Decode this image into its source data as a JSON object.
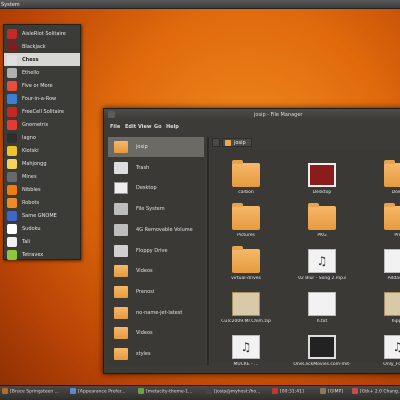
{
  "topbar": {
    "system_label": "System"
  },
  "games_menu": {
    "items": [
      {
        "label": "AisleRiot Solitaire",
        "color": "#c62828"
      },
      {
        "label": "Blackjack",
        "color": "#7b1f1f"
      },
      {
        "label": "Chess",
        "color": "#e0e0e0"
      },
      {
        "label": "Ethello",
        "color": "#b0b0b0"
      },
      {
        "label": "Five or More",
        "color": "#e84e3c"
      },
      {
        "label": "Four-in-a-Row",
        "color": "#3f7fd1"
      },
      {
        "label": "FreeCell Solitaire",
        "color": "#c62828"
      },
      {
        "label": "Gnometris",
        "color": "#e53935"
      },
      {
        "label": "Iagno",
        "color": "#2e2e2e"
      },
      {
        "label": "Klotski",
        "color": "#f2c12e"
      },
      {
        "label": "Mahjongg",
        "color": "#f5d25f"
      },
      {
        "label": "Mines",
        "color": "#6a6a6a"
      },
      {
        "label": "Nibbles",
        "color": "#ef7d0f"
      },
      {
        "label": "Robots",
        "color": "#ed8c22"
      },
      {
        "label": "Same GNOME",
        "color": "#3f67c9"
      },
      {
        "label": "Sudoku",
        "color": "#ffffff"
      },
      {
        "label": "Tali",
        "color": "#f0f0f0"
      },
      {
        "label": "Tetravex",
        "color": "#8cc63f"
      }
    ],
    "active_index": 2
  },
  "file_manager": {
    "title": "josip - File Manager",
    "menubar": [
      "File",
      "Edit",
      "View",
      "Go",
      "Help"
    ],
    "path_label": "josip",
    "sidebar": [
      {
        "label": "josip",
        "icon": "home-folder-icon"
      },
      {
        "label": "Trash",
        "icon": "trash-icon"
      },
      {
        "label": "Desktop",
        "icon": "desktop-icon"
      },
      {
        "label": "File System",
        "icon": "drive-icon"
      },
      {
        "label": "4G Removable Volume",
        "icon": "drive-icon"
      },
      {
        "label": "Floppy Drive",
        "icon": "floppy-icon"
      },
      {
        "label": "Videos",
        "icon": "folder-icon"
      },
      {
        "label": "Prenosi",
        "icon": "folder-icon"
      },
      {
        "label": "no-name-jet-latest",
        "icon": "folder-icon"
      },
      {
        "label": "Videos",
        "icon": "folder-icon"
      },
      {
        "label": "styles",
        "icon": "folder-icon"
      }
    ],
    "files": [
      {
        "label": "carbon",
        "type": "folder"
      },
      {
        "label": "Desktop",
        "type": "desktop"
      },
      {
        "label": "Down",
        "type": "folder"
      },
      {
        "label": "Pictures",
        "type": "folder"
      },
      {
        "label": "PKG",
        "type": "folder"
      },
      {
        "label": "Pre",
        "type": "folder"
      },
      {
        "label": "virtual-drives",
        "type": "folder"
      },
      {
        "label": "02 Blur - Song 2.mp3",
        "type": "mp3"
      },
      {
        "label": "Addas_Gl",
        "type": "doc"
      },
      {
        "label": "CuTc2009.Mr.Chim.zip",
        "type": "zip"
      },
      {
        "label": "h.txt",
        "type": "doc"
      },
      {
        "label": "hipph",
        "type": "zip"
      },
      {
        "label": "MUCKE - ...",
        "type": "mp3"
      },
      {
        "label": "OneClickMovies.com-mit-",
        "type": "video"
      },
      {
        "label": "Only_Fools_A",
        "type": "mp3"
      }
    ]
  },
  "taskbar": {
    "tasks": [
      {
        "label": "[Bruce Springsteen ...",
        "color": "#b36b2a"
      },
      {
        "label": "[Appearance Prefer...",
        "color": "#5a88c9"
      },
      {
        "label": "[metacity-theme-1...",
        "color": "#6aa14a"
      },
      {
        "label": "[josip@myhost:/ho...",
        "color": "#444"
      },
      {
        "label": "[00:31:41]",
        "color": "#c0392b"
      },
      {
        "label": "[GIMP]",
        "color": "#8a7a5a"
      },
      {
        "label": "[Gtk+ 2.0 Chang...",
        "color": "#c94c4c"
      }
    ]
  }
}
